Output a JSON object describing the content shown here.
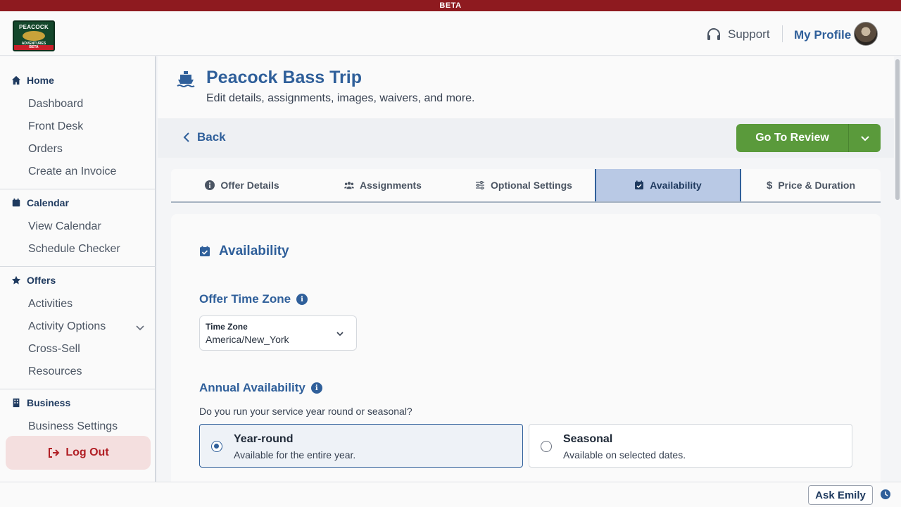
{
  "banner": {
    "text": "BETA"
  },
  "logo": {
    "line1": "PEACOCK",
    "line2": "ADVENTURES",
    "line3": "BETA"
  },
  "header": {
    "support_label": "Support",
    "profile_label": "My Profile"
  },
  "sidebar": {
    "sections": [
      {
        "title": "Home",
        "icon": "home-icon",
        "items": [
          "Dashboard",
          "Front Desk",
          "Orders",
          "Create an Invoice"
        ]
      },
      {
        "title": "Calendar",
        "icon": "calendar-icon",
        "items": [
          "View Calendar",
          "Schedule Checker"
        ]
      },
      {
        "title": "Offers",
        "icon": "star-icon",
        "items": [
          "Activities",
          "Activity Options",
          "Cross-Sell",
          "Resources"
        ]
      },
      {
        "title": "Business",
        "icon": "building-icon",
        "items": [
          "Business Settings"
        ]
      }
    ],
    "logout_label": "Log Out"
  },
  "page": {
    "title": "Peacock Bass Trip",
    "subtitle": "Edit details, assignments, images, waivers, and more.",
    "back_label": "Back",
    "review_label": "Go To Review"
  },
  "tabs": [
    {
      "label": "Offer Details",
      "icon": "info-icon",
      "active": false
    },
    {
      "label": "Assignments",
      "icon": "users-icon",
      "active": false
    },
    {
      "label": "Optional Settings",
      "icon": "sliders-icon",
      "active": false
    },
    {
      "label": "Availability",
      "icon": "calendar-check-icon",
      "active": true
    },
    {
      "label": "Price & Duration",
      "icon": "dollar-icon",
      "active": false
    }
  ],
  "availability": {
    "title": "Availability",
    "timezone_heading": "Offer Time Zone",
    "timezone_field_label": "Time Zone",
    "timezone_value": "America/New_York",
    "annual_heading": "Annual Availability",
    "question": "Do you run your service year round or seasonal?",
    "options": [
      {
        "title": "Year-round",
        "description": "Available for the entire year.",
        "selected": true
      },
      {
        "title": "Seasonal",
        "description": "Available on selected dates.",
        "selected": false
      }
    ]
  },
  "footer": {
    "ask_label": "Ask Emily"
  },
  "colors": {
    "accent": "#2f5f9a",
    "brand_red": "#8e1a1f",
    "review_green": "#5a9a3b",
    "active_tab": "#b9c9e5"
  }
}
